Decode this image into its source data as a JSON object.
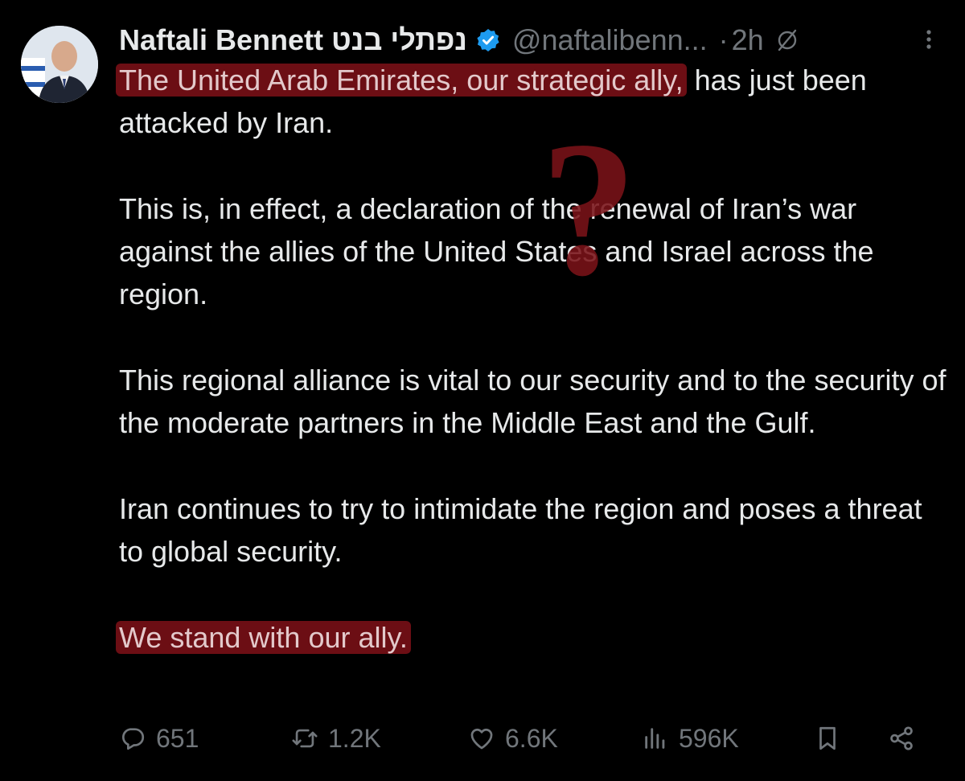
{
  "tweet": {
    "author_name": "Naftali Bennett נפתלי בנט",
    "handle": "@naftalibenn...",
    "separator": "·",
    "time": "2h",
    "paragraphs": [
      {
        "highlighted": "The United Arab Emirates, our strategic ally,",
        "rest": " has just been attacked by Iran."
      },
      {
        "highlighted": "",
        "rest": "This is, in effect, a declaration of the renewal of Iran’s war against the allies of the United States and Israel across the region."
      },
      {
        "highlighted": "",
        "rest": "This regional alliance is vital to our security and to the security of the moderate partners in the Middle East and the Gulf."
      },
      {
        "highlighted": "",
        "rest": "Iran continues to try to intimidate the region and poses a threat to global security."
      },
      {
        "highlighted": "We stand with our ally.",
        "rest": ""
      }
    ],
    "annotation_mark": "?",
    "stats": {
      "replies": "651",
      "reposts": "1.2K",
      "likes": "6.6K",
      "views": "596K"
    }
  },
  "icons": {
    "verified": "verified-badge-icon",
    "grok": "slashed-circle-icon",
    "more": "more-vertical-icon",
    "reply": "reply-icon",
    "repost": "repost-icon",
    "like": "heart-icon",
    "views": "views-bar-icon",
    "bookmark": "bookmark-icon",
    "share": "share-icon"
  },
  "colors": {
    "background": "#000000",
    "text": "#e7e9ea",
    "muted": "#71767b",
    "verified": "#1d9bf0",
    "highlight": "#96141c",
    "annotation": "#7a1218"
  }
}
